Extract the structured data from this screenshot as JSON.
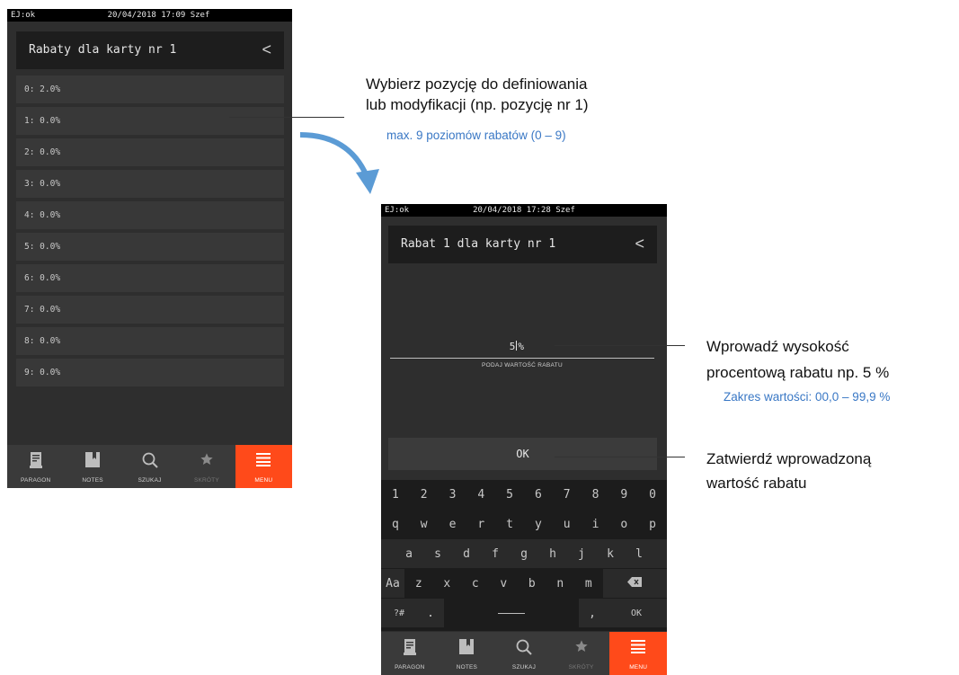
{
  "screen1": {
    "status": {
      "left": "EJ:ok",
      "datetime": "20/04/2018 17:09 Szef"
    },
    "title": "Rabaty dla karty nr 1",
    "back_glyph": "<",
    "items": [
      "0: 2.0%",
      "1: 0.0%",
      "2: 0.0%",
      "3: 0.0%",
      "4: 0.0%",
      "5: 0.0%",
      "6: 0.0%",
      "7: 0.0%",
      "8: 0.0%",
      "9: 0.0%"
    ]
  },
  "screen2": {
    "status": {
      "left": "EJ:ok",
      "datetime": "20/04/2018 17:28 Szef"
    },
    "title": "Rabat 1 dla karty nr 1",
    "back_glyph": "<",
    "input_value": "5",
    "input_suffix": "%",
    "input_hint": "PODAJ WARTOŚĆ RABATU",
    "ok_label": "OK",
    "keyboard": {
      "row1": [
        "1",
        "2",
        "3",
        "4",
        "5",
        "6",
        "7",
        "8",
        "9",
        "0"
      ],
      "row2": [
        "q",
        "w",
        "e",
        "r",
        "t",
        "y",
        "u",
        "i",
        "o",
        "p"
      ],
      "row3": [
        "a",
        "s",
        "d",
        "f",
        "g",
        "h",
        "j",
        "k",
        "l"
      ],
      "row4": [
        "Aa",
        "z",
        "x",
        "c",
        "v",
        "b",
        "n",
        "m"
      ],
      "backspace_icon": "backspace-icon",
      "sym_label": "?#",
      "dot_label": ".",
      "comma_label": ",",
      "ok_label": "OK"
    }
  },
  "nav": [
    {
      "label": "PARAGON",
      "icon": "receipt-icon"
    },
    {
      "label": "NOTES",
      "icon": "bookmark-icon"
    },
    {
      "label": "SZUKAJ",
      "icon": "search-icon"
    },
    {
      "label": "SKRÓTY",
      "icon": "star-icon"
    },
    {
      "label": "MENU",
      "icon": "menu-icon"
    }
  ],
  "annotations": {
    "a1_line1": "Wybierz pozycję do definiowania",
    "a1_line2": "lub modyfikacji (np. pozycję nr 1)",
    "a1_sub": "max. 9 poziomów rabatów (0 – 9)",
    "a2_line1": "Wprowadź wysokość",
    "a2_line2": "procentową rabatu np. 5 %",
    "a2_sub": "Zakres wartości: 00,0 – 99,9 %",
    "a3_line1": "Zatwierdź wprowadzoną",
    "a3_line2": "wartość rabatu"
  },
  "colors": {
    "accent": "#ff4a1a",
    "annotation_blue": "#3a78c5",
    "arrow": "#5b9bd5"
  }
}
